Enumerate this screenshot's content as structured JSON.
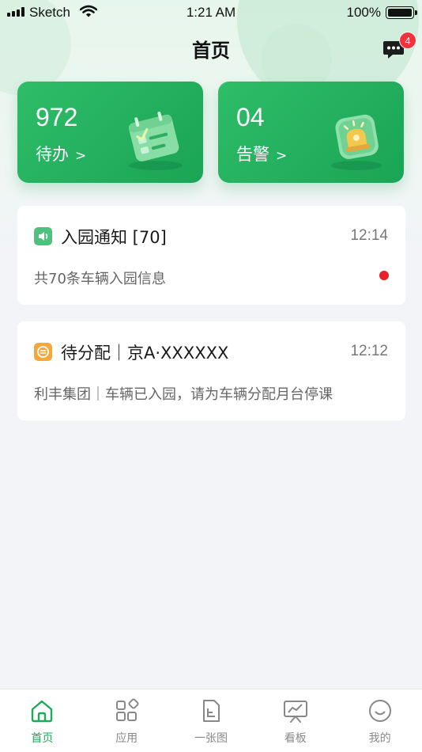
{
  "status_bar": {
    "carrier": "Sketch",
    "time": "1:21 AM",
    "battery_percent": "100%",
    "icons": [
      "signal-icon",
      "wifi-icon",
      "battery-icon"
    ]
  },
  "header": {
    "title": "首页",
    "message_badge_count": "4",
    "message_icon": "chat-bubble-icon"
  },
  "stats": [
    {
      "value": "972",
      "label": "待办",
      "chevron": ">",
      "icon": "calendar-todo-icon"
    },
    {
      "value": "04",
      "label": "告警",
      "chevron": ">",
      "icon": "alarm-siren-icon"
    }
  ],
  "notices": [
    {
      "title": "入园通知 [70]",
      "time": "12:14",
      "body": "共70条车辆入园信息",
      "icon": "speaker-icon",
      "icon_color": "#4fc17f",
      "unread": true
    },
    {
      "title": "待分配｜京A·XXXXXX",
      "time": "12:12",
      "body": "利丰集团｜车辆已入园，请为车辆分配月台停课",
      "icon": "assign-icon",
      "icon_color": "#f4a73b",
      "unread": false
    }
  ],
  "tabs": [
    {
      "label": "首页",
      "icon": "home-icon",
      "active": true
    },
    {
      "label": "应用",
      "icon": "apps-icon",
      "active": false
    },
    {
      "label": "一张图",
      "icon": "map-doc-icon",
      "active": false
    },
    {
      "label": "看板",
      "icon": "dashboard-icon",
      "active": false
    },
    {
      "label": "我的",
      "icon": "profile-icon",
      "active": false
    }
  ],
  "colors": {
    "brand_green": "#1faa5a",
    "badge_red": "#f2333d",
    "unread_dot": "#e8202a"
  }
}
